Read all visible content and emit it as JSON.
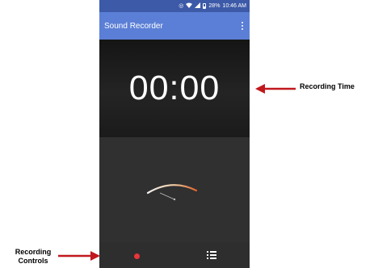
{
  "status_bar": {
    "battery_percent": "28%",
    "time": "10:46 AM",
    "icons": [
      "alarm-icon",
      "wifi-icon",
      "signal-icon",
      "battery-icon"
    ]
  },
  "app_bar": {
    "title": "Sound Recorder",
    "menu_icon": "overflow-menu-icon"
  },
  "timer": {
    "value": "00:00"
  },
  "controls": {
    "record_icon": "record-icon",
    "list_icon": "recordings-list-icon"
  },
  "annotations": {
    "recording_time": "Recording Time",
    "recording_controls_line1": "Recording",
    "recording_controls_line2": "Controls"
  },
  "colors": {
    "status_bar": "#3d5aa8",
    "app_bar": "#5b7fd6",
    "record": "#e8353b",
    "arrow": "#c0181d",
    "meter_gradient_end": "#e0642a"
  }
}
